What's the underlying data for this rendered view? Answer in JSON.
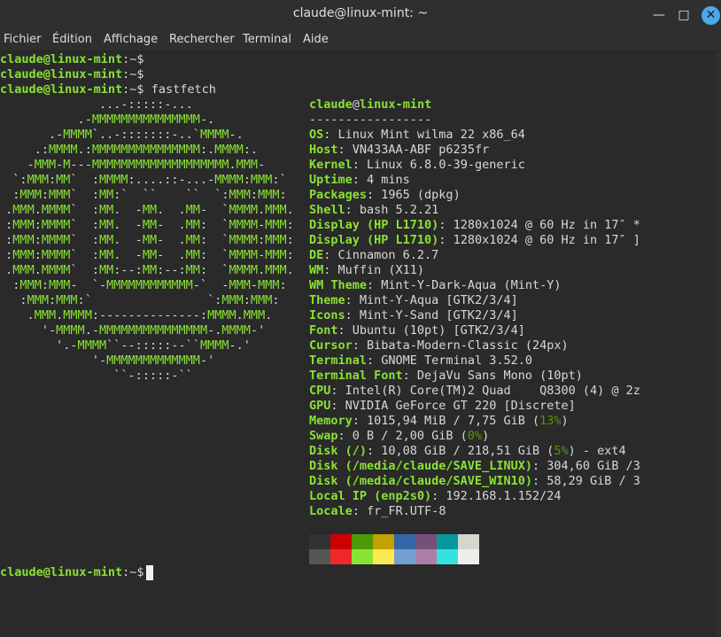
{
  "window": {
    "title": "claude@linux-mint: ~",
    "min_icon": "minimize-icon",
    "max_icon": "maximize-icon",
    "close_icon": "close-icon"
  },
  "menu": [
    "Fichier",
    "Édition",
    "Affichage",
    "Rechercher",
    "Terminal",
    "Aide"
  ],
  "prompts": [
    {
      "user": "claude@linux-mint",
      "sep": ":~$",
      "cmd": ""
    },
    {
      "user": "claude@linux-mint",
      "sep": ":~$",
      "cmd": ""
    },
    {
      "user": "claude@linux-mint",
      "sep": ":~$",
      "cmd": " fastfetch"
    }
  ],
  "final_prompt": {
    "user": "claude@linux-mint",
    "sep": ":~$ "
  },
  "logo": [
    "              ...-:::::-...",
    "           .-MMMMMMMMMMMMMMM-.",
    "       .-MMMM`..-:::::::-..`MMMM-.",
    "     .:MMMM.:MMMMMMMMMMMMMMM:.MMMM:.",
    "    -MMM-M---MMMMMMMMMMMMMMMMMMM.MMM-",
    "  `:MMM:MM`  :MMMM:....::-...-MMMM:MMM:`",
    "  :MMM:MMM`  :MM:`  ``    ``  `:MMM:MMM:",
    " .MMM.MMMM`  :MM.  -MM.  .MM-  `MMMM.MMM.",
    " :MMM:MMMM`  :MM.  -MM-  .MM:  `MMMM-MMM:",
    " :MMM:MMMM`  :MM.  -MM-  .MM:  `MMMM:MMM:",
    " :MMM:MMMM`  :MM.  -MM-  .MM:  `MMMM-MMM:",
    " .MMM.MMMM`  :MM:--:MM:--:MM:  `MMMM.MMM.",
    "  :MMM:MMM-  `-MMMMMMMMMMMM-`  -MMM-MMM:",
    "   :MMM:MMM:`                `:MMM:MMM:",
    "    .MMM.MMMM:--------------:MMMM.MMM.",
    "      '-MMMM.-MMMMMMMMMMMMMMM-.MMMM-'",
    "        '.-MMMM``--:::::--``MMMM-.'",
    "             '-MMMMMMMMMMMMM-'",
    "                ``-:::::-``"
  ],
  "info_header": {
    "user": "claude",
    "at": "@",
    "host": "linux-mint",
    "rule": "-----------------"
  },
  "info": [
    {
      "key": "OS",
      "value": ": Linux Mint wilma 22 x86_64"
    },
    {
      "key": "Host",
      "value": ": VN433AA-ABF p6235fr"
    },
    {
      "key": "Kernel",
      "value": ": Linux 6.8.0-39-generic"
    },
    {
      "key": "Uptime",
      "value": ": 4 mins"
    },
    {
      "key": "Packages",
      "value": ": 1965 (dpkg)"
    },
    {
      "key": "Shell",
      "value": ": bash 5.2.21"
    },
    {
      "key": "Display (HP L1710)",
      "value": ": 1280x1024 @ 60 Hz in 17″ *"
    },
    {
      "key": "Display (HP L1710)",
      "value": ": 1280x1024 @ 60 Hz in 17″ ]"
    },
    {
      "key": "DE",
      "value": ": Cinnamon 6.2.7"
    },
    {
      "key": "WM",
      "value": ": Muffin (X11)"
    },
    {
      "key": "WM Theme",
      "value": ": Mint-Y-Dark-Aqua (Mint-Y)"
    },
    {
      "key": "Theme",
      "value": ": Mint-Y-Aqua [GTK2/3/4]"
    },
    {
      "key": "Icons",
      "value": ": Mint-Y-Sand [GTK2/3/4]"
    },
    {
      "key": "Font",
      "value": ": Ubuntu (10pt) [GTK2/3/4]"
    },
    {
      "key": "Cursor",
      "value": ": Bibata-Modern-Classic (24px)"
    },
    {
      "key": "Terminal",
      "value": ": GNOME Terminal 3.52.0"
    },
    {
      "key": "Terminal Font",
      "value": ": DejaVu Sans Mono (10pt)"
    },
    {
      "key": "CPU",
      "value": ": Intel(R) Core(TM)2 Quad    Q8300 (4) @ 2z"
    },
    {
      "key": "GPU",
      "value": ": NVIDIA GeForce GT 220 [Discrete]"
    },
    {
      "key": "Memory",
      "value": ": 1015,94 MiB / 7,75 GiB (",
      "pct": "13%",
      "tail": ")"
    },
    {
      "key": "Swap",
      "value": ": 0 B / 2,00 GiB (",
      "pct": "0%",
      "tail": ")"
    },
    {
      "key": "Disk (/)",
      "value": ": 10,08 GiB / 218,51 GiB (",
      "pct": "5%",
      "tail": ") - ext4"
    },
    {
      "key": "Disk (/media/claude/SAVE_LINUX)",
      "value": ": 304,60 GiB /3"
    },
    {
      "key": "Disk (/media/claude/SAVE_WIN10)",
      "value": ": 58,29 GiB / 3"
    },
    {
      "key": "Local IP (enp2s0)",
      "value": ": 192.168.1.152/24"
    },
    {
      "key": "Locale",
      "value": ": fr_FR.UTF-8"
    }
  ],
  "palette_row1": [
    "#2e3436",
    "#cc0000",
    "#4e9a06",
    "#c4a000",
    "#3465a4",
    "#75507b",
    "#06989a",
    "#d3d7cf"
  ],
  "palette_row2": [
    "#555753",
    "#ef2929",
    "#8ae234",
    "#fce94f",
    "#729fcf",
    "#ad7fa8",
    "#34e2e2",
    "#eeeeec"
  ],
  "colors": {
    "prompt_green": "#8ae234",
    "text": "#d8d8d8",
    "bg": "#2a2a2a",
    "accent": "#4aa9e9"
  }
}
